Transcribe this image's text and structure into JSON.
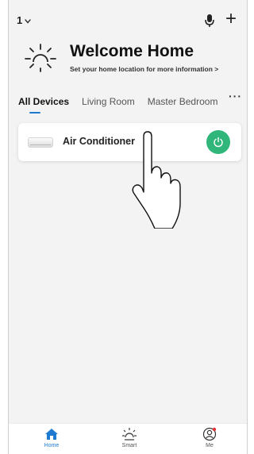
{
  "header": {
    "home_selector": "1",
    "chevron_icon": "chevron-down-icon",
    "mic_icon": "microphone-icon",
    "add_icon": "plus-icon",
    "add_label": "+"
  },
  "welcome": {
    "icon": "sun-icon",
    "title": "Welcome Home",
    "subtitle": "Set your home location for more information >"
  },
  "tabs": [
    {
      "label": "All Devices",
      "active": true
    },
    {
      "label": "Living Room",
      "active": false
    },
    {
      "label": "Master Bedroom",
      "active": false
    }
  ],
  "more_label": "···",
  "devices": [
    {
      "name": "Air Conditioner",
      "icon": "air-conditioner-icon",
      "power": "on",
      "power_color": "#30b67a"
    }
  ],
  "bottom_nav": [
    {
      "label": "Home",
      "icon": "home-icon",
      "active": true
    },
    {
      "label": "Smart",
      "icon": "sun-icon",
      "active": false
    },
    {
      "label": "Me",
      "icon": "user-icon",
      "active": false
    }
  ],
  "colors": {
    "accent": "#1e7ad0",
    "power_on": "#30b67a",
    "background": "#f3f3f3"
  }
}
